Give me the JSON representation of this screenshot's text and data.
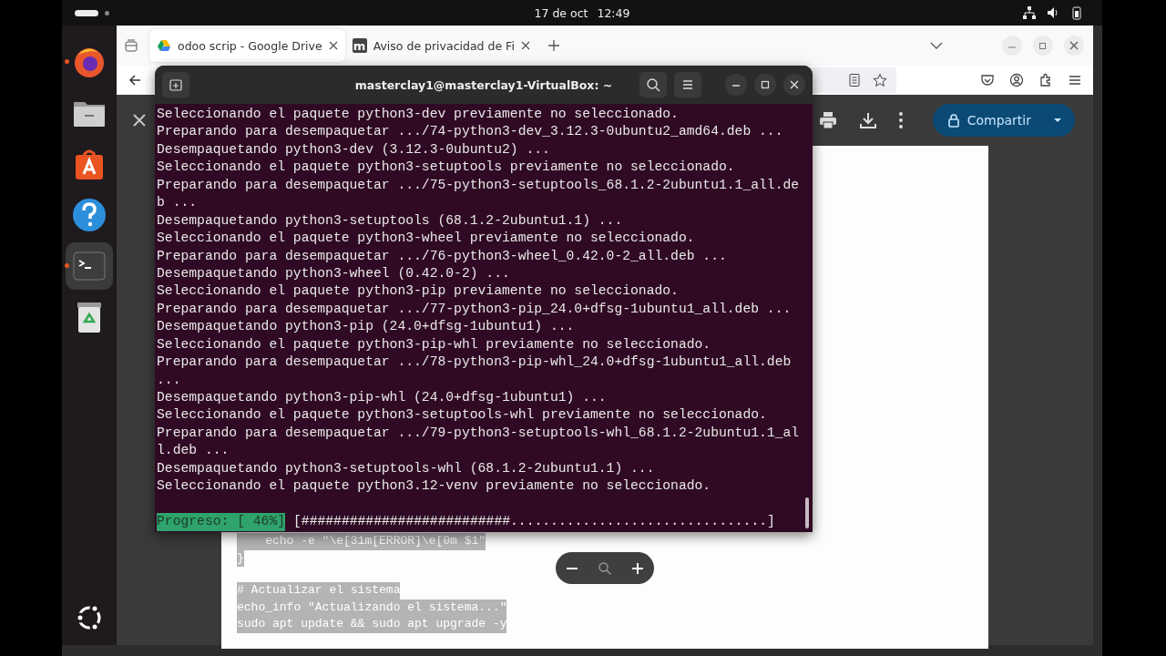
{
  "top_bar": {
    "date": "17 de oct",
    "time": "12:49"
  },
  "dock": {
    "items": [
      {
        "kind": "firefox",
        "running": true,
        "selected": false
      },
      {
        "kind": "files",
        "running": false,
        "selected": false
      },
      {
        "kind": "app-center",
        "running": false,
        "selected": false
      },
      {
        "kind": "help",
        "running": false,
        "selected": false
      },
      {
        "kind": "terminal",
        "running": true,
        "selected": true
      },
      {
        "kind": "trash",
        "running": false,
        "selected": false
      }
    ]
  },
  "browser": {
    "tabs": [
      {
        "title": "odoo scrip - Google Drive",
        "kind": "drive",
        "selected": true
      },
      {
        "title": "Aviso de privacidad de Fi",
        "kind": "letter",
        "favicon_letter": "m",
        "selected": false
      }
    ]
  },
  "viewer": {
    "share_button": "Compartir",
    "document_blocks": [
      [
        "    echo -e \"\\e[31m[ERROR]\\e[0m $1\"",
        "}"
      ],
      [
        "# Actualizar el sistema",
        "echo_info \"Actualizando el sistema...\"",
        "sudo apt update && sudo apt upgrade -y"
      ]
    ]
  },
  "terminal": {
    "title": "masterclay1@masterclay1-VirtualBox: ~",
    "lines": [
      "Seleccionando el paquete python3-dev previamente no seleccionado.",
      "Preparando para desempaquetar .../74-python3-dev_3.12.3-0ubuntu2_amd64.deb ...",
      "Desempaquetando python3-dev (3.12.3-0ubuntu2) ...",
      "Seleccionando el paquete python3-setuptools previamente no seleccionado.",
      "Preparando para desempaquetar .../75-python3-setuptools_68.1.2-2ubuntu1.1_all.de",
      "b ...",
      "Desempaquetando python3-setuptools (68.1.2-2ubuntu1.1) ...",
      "Seleccionando el paquete python3-wheel previamente no seleccionado.",
      "Preparando para desempaquetar .../76-python3-wheel_0.42.0-2_all.deb ...",
      "Desempaquetando python3-wheel (0.42.0-2) ...",
      "Seleccionando el paquete python3-pip previamente no seleccionado.",
      "Preparando para desempaquetar .../77-python3-pip_24.0+dfsg-1ubuntu1_all.deb ...",
      "Desempaquetando python3-pip (24.0+dfsg-1ubuntu1) ...",
      "Seleccionando el paquete python3-pip-whl previamente no seleccionado.",
      "Preparando para desempaquetar .../78-python3-pip-whl_24.0+dfsg-1ubuntu1_all.deb",
      "...",
      "Desempaquetando python3-pip-whl (24.0+dfsg-1ubuntu1) ...",
      "Seleccionando el paquete python3-setuptools-whl previamente no seleccionado.",
      "Preparando para desempaquetar .../79-python3-setuptools-whl_68.1.2-2ubuntu1.1_al",
      "l.deb ...",
      "Desempaquetando python3-setuptools-whl (68.1.2-2ubuntu1.1) ...",
      "Seleccionando el paquete python3.12-venv previamente no seleccionado."
    ],
    "progress_label": "Progreso: [ 46%]",
    "progress_bar": "[##########################................................]"
  }
}
